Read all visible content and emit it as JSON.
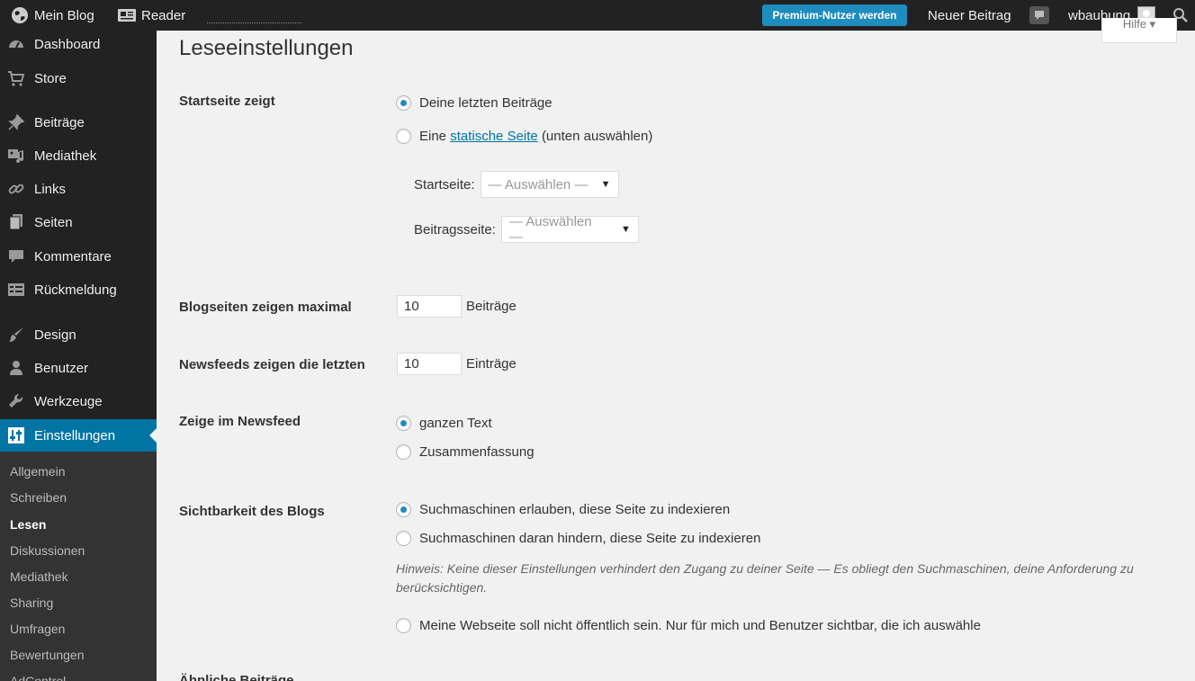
{
  "adminbar": {
    "blog_label": "Mein Blog",
    "reader_label": "Reader",
    "premium_label": "Premium-Nutzer werden",
    "new_post_label": "Neuer Beitrag",
    "username": "wbaubung"
  },
  "help_tab": "Hilfe ▾",
  "sidebar": {
    "items": [
      {
        "label": "Dashboard",
        "icon": "dashboard-icon"
      },
      {
        "label": "Store",
        "icon": "cart-icon"
      },
      {
        "label": "Beiträge",
        "icon": "pin-icon"
      },
      {
        "label": "Mediathek",
        "icon": "media-icon"
      },
      {
        "label": "Links",
        "icon": "link-icon"
      },
      {
        "label": "Seiten",
        "icon": "pages-icon"
      },
      {
        "label": "Kommentare",
        "icon": "comment-icon"
      },
      {
        "label": "Rückmeldung",
        "icon": "feedback-icon"
      },
      {
        "label": "Design",
        "icon": "brush-icon"
      },
      {
        "label": "Benutzer",
        "icon": "user-icon"
      },
      {
        "label": "Werkzeuge",
        "icon": "wrench-icon"
      },
      {
        "label": "Einstellungen",
        "icon": "settings-icon"
      }
    ],
    "submenu": [
      "Allgemein",
      "Schreiben",
      "Lesen",
      "Diskussionen",
      "Mediathek",
      "Sharing",
      "Umfragen",
      "Bewertungen",
      "AdControl"
    ]
  },
  "page": {
    "title": "Leseeinstellungen",
    "front_page": {
      "label": "Startseite zeigt",
      "option_latest": "Deine letzten Beiträge",
      "option_static_prefix": "Eine",
      "option_static_link": "statische Seite",
      "option_static_suffix": "(unten auswählen)",
      "startseite_label": "Startseite:",
      "startseite_value": "— Auswählen —",
      "beitragsseite_label": "Beitragsseite:",
      "beitragsseite_value": "— Auswählen —"
    },
    "posts_per_page": {
      "label": "Blogseiten zeigen maximal",
      "value": "10",
      "unit": "Beiträge"
    },
    "feed_items": {
      "label": "Newsfeeds zeigen die letzten",
      "value": "10",
      "unit": "Einträge"
    },
    "feed_content": {
      "label": "Zeige im Newsfeed",
      "option_full": "ganzen Text",
      "option_summary": "Zusammenfassung"
    },
    "visibility": {
      "label": "Sichtbarkeit des Blogs",
      "option_allow": "Suchmaschinen erlauben, diese Seite zu indexieren",
      "option_block": "Suchmaschinen daran hindern, diese Seite zu indexieren",
      "hint": "Hinweis: Keine dieser Einstellungen verhindert den Zugang zu deiner Seite — Es obliegt den Suchmaschinen, deine Anforderung zu berücksichtigen.",
      "option_private": "Meine Webseite soll nicht öffentlich sein. Nur für mich und Benutzer sichtbar, die ich auswähle"
    },
    "next_section_label": "Ähnliche Beiträge"
  },
  "colors": {
    "accent": "#0074a2",
    "adminbar": "#222222",
    "premium": "#1e8cbe"
  }
}
